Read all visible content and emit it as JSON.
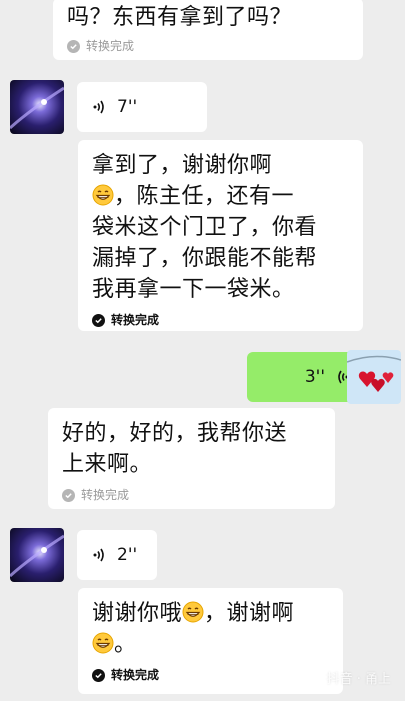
{
  "messages": {
    "top_partial": {
      "text": "吗？东西有拿到了吗？",
      "status": "转换完成"
    },
    "voice1": {
      "duration": "7''"
    },
    "transcript1": {
      "line1": "拿到了，谢谢你啊",
      "line2_after_emoji": "，陈主任，还有一",
      "line3": "袋米这个门卫了，你看",
      "line4": "漏掉了，你跟能不能帮",
      "line5": "我再拿一下一袋米。",
      "status": "转换完成"
    },
    "voice_sent": {
      "duration": "3''"
    },
    "reply": {
      "line1": "好的，好的，我帮你送",
      "line2": "上来啊。",
      "status": "转换完成"
    },
    "voice2": {
      "duration": "2''"
    },
    "transcript2": {
      "part1": "谢谢你哦",
      "part2": "，谢谢啊",
      "part3": "。",
      "status": "转换完成"
    }
  },
  "icons": {
    "voice_icon": "sound-wave-icon",
    "emoji": "grinning-face-icon",
    "check": "check-circle-icon"
  },
  "colors": {
    "background": "#ededed",
    "incoming_bubble": "#ffffff",
    "outgoing_bubble": "#95ec69"
  },
  "watermark": "抖音 · 甬上"
}
